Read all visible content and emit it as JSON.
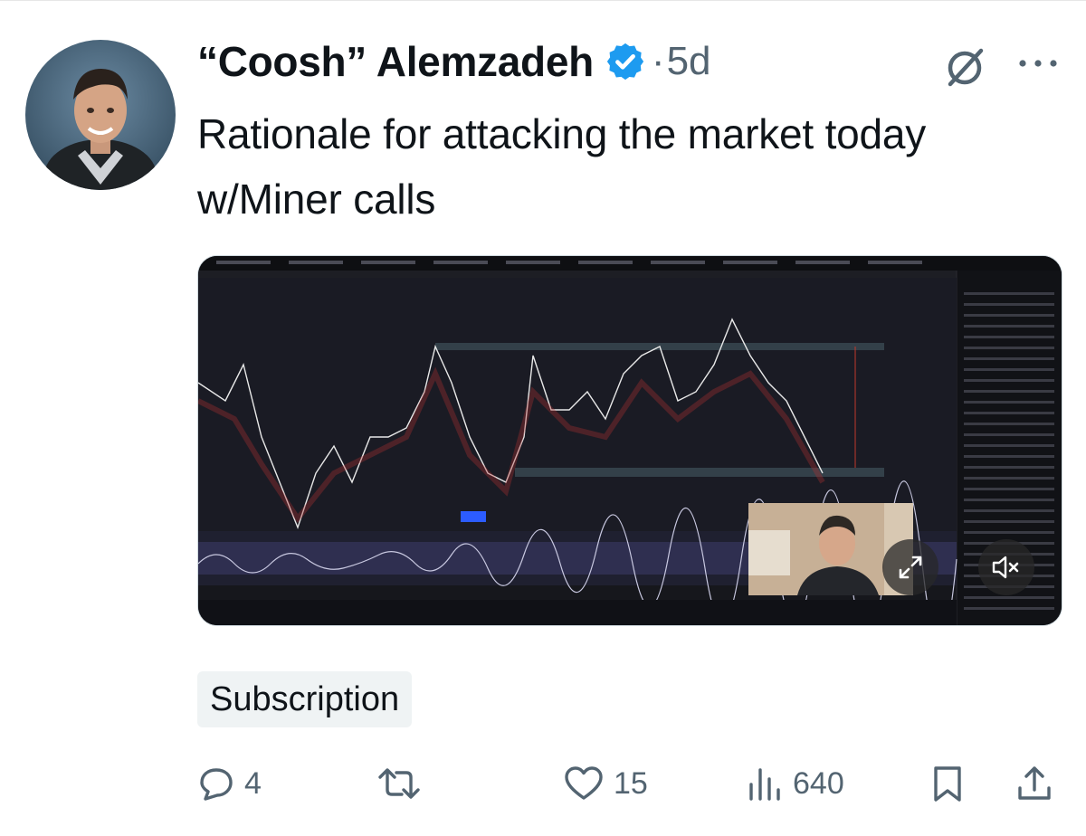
{
  "tweet": {
    "author_name": "“Coosh” Alemzadeh",
    "separator": "·",
    "time_ago": "5d",
    "text": "Rationale for attacking the market today w/Miner calls",
    "label": "Subscription"
  },
  "icons": {
    "verified": "verified-badge-icon",
    "grok": "grok-icon",
    "more": "more-options-icon",
    "expand": "expand-icon",
    "mute": "muted-speaker-icon"
  },
  "actions": {
    "replies": "4",
    "retweets": "",
    "likes": "15",
    "views": "640"
  },
  "colors": {
    "verified_blue": "#1d9bf0",
    "secondary_text": "#536471",
    "label_bg": "#eff3f4"
  }
}
